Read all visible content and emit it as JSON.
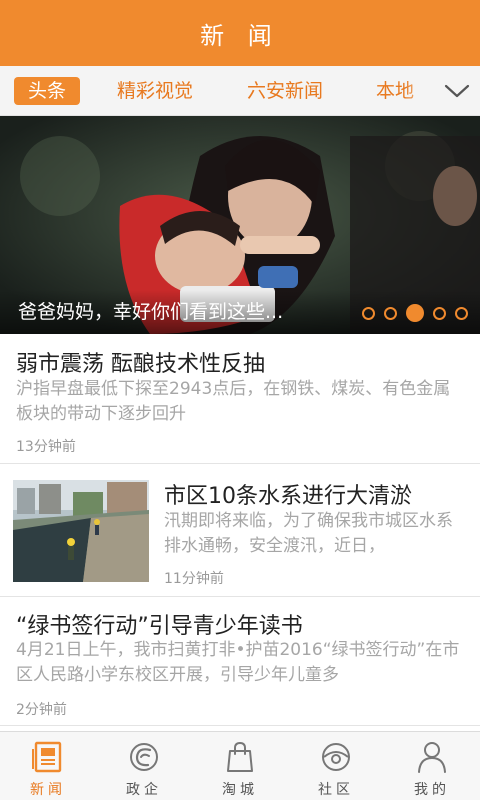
{
  "header": {
    "title": "新 闻"
  },
  "tabs": [
    {
      "label": "头条",
      "active": true
    },
    {
      "label": "精彩视觉",
      "active": false
    },
    {
      "label": "六安新闻",
      "active": false
    },
    {
      "label": "本地",
      "active": false
    }
  ],
  "banner": {
    "caption": "爸爸妈妈，幸好你们看到这些...",
    "slide_count": 5,
    "active_slide": 3
  },
  "news": [
    {
      "title": "弱市震荡  酝酿技术性反抽",
      "summary": "沪指早盘最低下探至2943点后，在钢铁、煤炭、有色金属板块的带动下逐步回升",
      "time": "13分钟前"
    },
    {
      "title": "市区10条水系进行大清淤",
      "summary": "汛期即将来临，为了确保我市城区水系排水通畅，安全渡汛，近日，",
      "time": "11分钟前"
    },
    {
      "title": "“绿书签行动”引导青少年读书",
      "summary": "4月21日上午，我市扫黄打非•护苗2016“绿书签行动”在市区人民路小学东校区开展，引导少年儿童多",
      "time": "2分钟前"
    }
  ],
  "bottom_nav": [
    {
      "label": "新闻",
      "icon": "newspaper-icon",
      "active": true
    },
    {
      "label": "政企",
      "icon": "government-icon",
      "active": false
    },
    {
      "label": "淘城",
      "icon": "shopping-bag-icon",
      "active": false
    },
    {
      "label": "社区",
      "icon": "community-icon",
      "active": false
    },
    {
      "label": "我的",
      "icon": "profile-icon",
      "active": false
    }
  ],
  "colors": {
    "accent": "#f08a2e",
    "active_text": "#e8791f",
    "muted_text": "#a6a6a6"
  }
}
